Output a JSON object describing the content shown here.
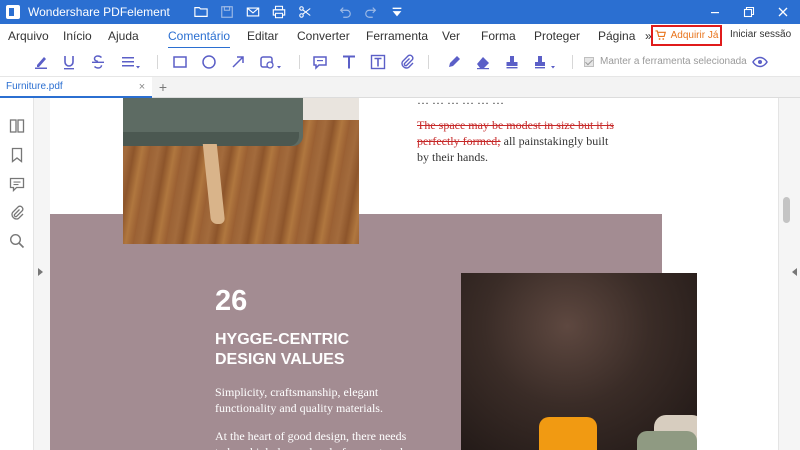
{
  "window": {
    "title": "Wondershare PDFelement",
    "icons": [
      "folder-icon",
      "save-icon",
      "mail-icon",
      "print-icon",
      "scissors-icon",
      "undo-icon",
      "redo-icon",
      "dropdown-icon"
    ],
    "controls": [
      "minimize-icon",
      "restore-icon",
      "close-icon"
    ]
  },
  "menu": {
    "items": [
      "Arquivo",
      "Início",
      "Ajuda",
      "Comentário",
      "Editar",
      "Converter",
      "Ferramenta",
      "Ver",
      "Forma",
      "Proteger",
      "Página"
    ],
    "active": "Comentário",
    "more": "»",
    "buy": "Adquirir Já",
    "login": "Iniciar sessão"
  },
  "toolbar": {
    "keep_tool_label": "Manter a ferramenta selecionada",
    "keep_tool_checked": true
  },
  "tabs": {
    "doc_name": "Furniture.pdf",
    "close": "×",
    "add": "+"
  },
  "document": {
    "top_cut_text": "… … … … … …",
    "strike_text": "The space may be modest in size but it is perfectly formed;",
    "rest_text": " all painstakingly built by their hands.",
    "number": "26",
    "heading": "HYGGE-CENTRIC DESIGN VALUES",
    "para1": "Simplicity, craftsmanship, elegant functionality and quality materials.",
    "para2": "At the heart of good design, there needs to be a high degree level of respect and"
  },
  "colors": {
    "brand_blue": "#2b6fd1",
    "annotation_purple": "#5b5fc7",
    "highlight_red": "#e01b1b",
    "buy_orange": "#e8741c",
    "pink_block": "#a38c92"
  }
}
